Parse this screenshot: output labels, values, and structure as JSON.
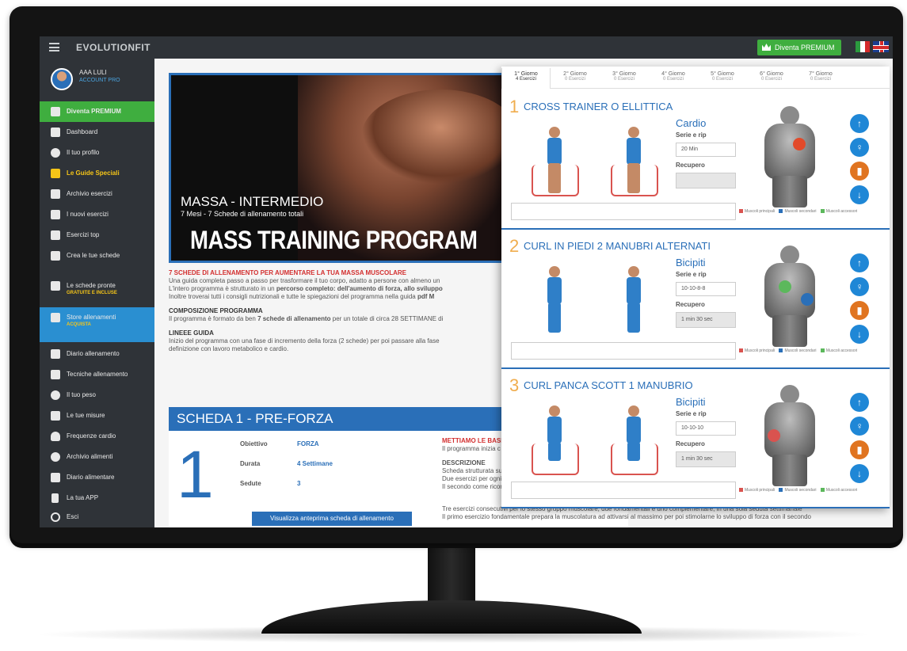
{
  "topbar": {
    "brand": "EVOLUTIONFIT",
    "premium_label": "Diventa PREMIUM"
  },
  "user": {
    "name": "AAA LULI",
    "role": "ACCOUNT PRO"
  },
  "sidebar": {
    "items": [
      {
        "label": "Diventa PREMIUM",
        "sub": ""
      },
      {
        "label": "Dashboard",
        "sub": ""
      },
      {
        "label": "Il tuo profilo",
        "sub": ""
      },
      {
        "label": "Le Guide Speciali",
        "sub": ""
      },
      {
        "label": "Archivio esercizi",
        "sub": ""
      },
      {
        "label": "I nuovi esercizi",
        "sub": ""
      },
      {
        "label": "Esercizi top",
        "sub": ""
      },
      {
        "label": "Crea le tue schede",
        "sub": ""
      },
      {
        "label": "Le schede pronte",
        "sub": "GRATUITE E INCLUSE"
      },
      {
        "label": "Store allenamenti",
        "sub": "ACQUISTA"
      },
      {
        "label": "Diario allenamento",
        "sub": ""
      },
      {
        "label": "Tecniche allenamento",
        "sub": ""
      },
      {
        "label": "Il tuo peso",
        "sub": ""
      },
      {
        "label": "Le tue misure",
        "sub": ""
      },
      {
        "label": "Frequenze cardio",
        "sub": ""
      },
      {
        "label": "Archivio alimenti",
        "sub": ""
      },
      {
        "label": "Diario alimentare",
        "sub": ""
      },
      {
        "label": "La tua APP",
        "sub": ""
      },
      {
        "label": "Esci",
        "sub": ""
      }
    ]
  },
  "hero": {
    "subtitle": "MASSA - INTERMEDIO",
    "meta": "7 Mesi - 7 Schede di allenamento totali",
    "title": "MASS TRAINING PROGRAM"
  },
  "intro": {
    "headline": "7 SCHEDE DI ALLENAMENTO PER AUMENTARE LA TUA MASSA MUSCOLARE",
    "p1": "Una guida completa passo a passo per trasformare il tuo corpo, adatto a persone con almeno un",
    "p2_a": "L'intero programma è strutturato in un ",
    "p2_b": "percorso completo: dell'aumento di forza, allo sviluppo",
    "p3_a": "Inoltre troverai tutti i consigli nutrizionali e tutte le spiegazioni del programma nella guida ",
    "p3_b": "pdf M",
    "sec1": "COMPOSIZIONE PROGRAMMA",
    "s1_a": "Il programma è formato da ben ",
    "s1_b": "7 schede di allenamento",
    "s1_c": " per un totale di circa 28 SETTIMANE di",
    "sec2": "LINEEE GUIDA",
    "s2_l1": "Inizio del programma con una fase di incremento della forza (2 schede) per poi passare alla fase",
    "s2_l2": "definizione con lavoro metabolico e cardio."
  },
  "scheda": {
    "header": "SCHEDA 1 - PRE-FORZA",
    "number": "1",
    "obiettivo_k": "Obiettivo",
    "obiettivo_v": "FORZA",
    "durata_k": "Durata",
    "durata_v": "4 Settimane",
    "sedute_k": "Sedute",
    "sedute_v": "3",
    "preview": "Visualizza anteprima scheda di allenamento",
    "red_title": "METTIAMO LE BASI D",
    "red_sub": "Il programma inizia c",
    "desc_title": "DESCRIZIONE",
    "desc1": "Scheda strutturata su",
    "desc2": "Due esercizi per ogni",
    "desc3": "Il secondo come ricom",
    "bottom1": "Tre esercizi consecutivi per lo stesso gruppo muscolare, due fondamentali e uno complementare, in una sola seduta settimanale",
    "bottom2": "Il primo esercizio fondamentale prepara la muscolatura ad attivarsi al massimo per poi stimolarne lo sviluppo di forza con il secondo"
  },
  "days": [
    {
      "label": "1° Giorno",
      "count": "4 Esercizi"
    },
    {
      "label": "2° Giorno",
      "count": "0 Esercizi"
    },
    {
      "label": "3° Giorno",
      "count": "0 Esercizi"
    },
    {
      "label": "4° Giorno",
      "count": "0 Esercizi"
    },
    {
      "label": "5° Giorno",
      "count": "0 Esercizi"
    },
    {
      "label": "6° Giorno",
      "count": "0 Esercizi"
    },
    {
      "label": "7° Giorno",
      "count": "0 Esercizi"
    }
  ],
  "exercises": [
    {
      "num": "1",
      "title": "CROSS TRAINER O ELLITTICA",
      "muscle": "Cardio",
      "serie_label": "Serie e rip",
      "serie": "20 Min",
      "rec_label": "Recupero",
      "rec": ""
    },
    {
      "num": "2",
      "title": "CURL IN PIEDI 2 MANUBRI ALTERNATI",
      "muscle": "Bicipiti",
      "serie_label": "Serie e rip",
      "serie": "10-10-8-8",
      "rec_label": "Recupero",
      "rec": "1 min 30 sec"
    },
    {
      "num": "3",
      "title": "CURL PANCA SCOTT 1 MANUBRIO",
      "muscle": "Bicipiti",
      "serie_label": "Serie e rip",
      "serie": "10-10-10",
      "rec_label": "Recupero",
      "rec": "1 min 30 sec"
    }
  ],
  "legend": {
    "primary": "Muscoli principali",
    "secondary": "Muscoli secondari",
    "accessory": "Muscoli accessori"
  },
  "colors": {
    "accent_blue": "#2a6fb8",
    "premium_green": "#3fae3f",
    "sidebar_bg": "#2f3338",
    "orange": "#f0ad4e"
  }
}
